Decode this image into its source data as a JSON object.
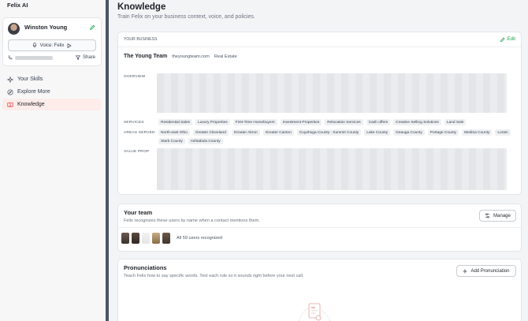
{
  "app": {
    "title": "Felix AI"
  },
  "profile": {
    "name": "Winston Young",
    "voice_label": "Voice: Felix",
    "share_label": "Share"
  },
  "nav": {
    "items": [
      {
        "label": "Your Skills",
        "icon": "sparkle-icon"
      },
      {
        "label": "Explore More",
        "icon": "compass-icon"
      },
      {
        "label": "Knowledge",
        "icon": "book-icon",
        "active": true
      }
    ]
  },
  "page": {
    "title": "Knowledge",
    "subtitle": "Train Felix on your business context, voice, and policies."
  },
  "business": {
    "header_label": "YOUR BUSINESS",
    "edit_label": "Edit",
    "name": "The Young Team",
    "website": "theyoungteam.com",
    "industry": "Real Estate",
    "overview_label": "OVERVIEW",
    "services_label": "SERVICES",
    "areas_label": "AREAS SERVED",
    "value_prop_label": "VALUE PROP",
    "services": [
      "Residential Sales",
      "Luxury Properties",
      "First-Time Homebuyers",
      "Investment Properties",
      "Relocation Services",
      "Cash offers",
      "Creative Selling Solutions",
      "Land Sale"
    ],
    "areas": [
      "North-east Ohio",
      "Greater Cleveland",
      "Greater Akron",
      "Greater Canton",
      "Cuyahoga County - Summit County",
      "Lake County",
      "Geauga County",
      "Portage County",
      "Medina County",
      "Lorain",
      "Stark County",
      "Ashtabula County"
    ]
  },
  "team": {
    "title": "Your team",
    "subtitle": "Felix recognizes these users by name when a contact mentions them.",
    "manage_label": "Manage",
    "count_text": "All 59 users recognized"
  },
  "pronunciations": {
    "title": "Pronunciations",
    "subtitle": "Teach Felix how to say specific words. Test each rule so it sounds right before your next call.",
    "add_label": "Add Pronunciation"
  },
  "colors": {
    "accent_green": "#16a34a",
    "active_nav_bg": "#fdecea",
    "divider": "#4b5563"
  }
}
